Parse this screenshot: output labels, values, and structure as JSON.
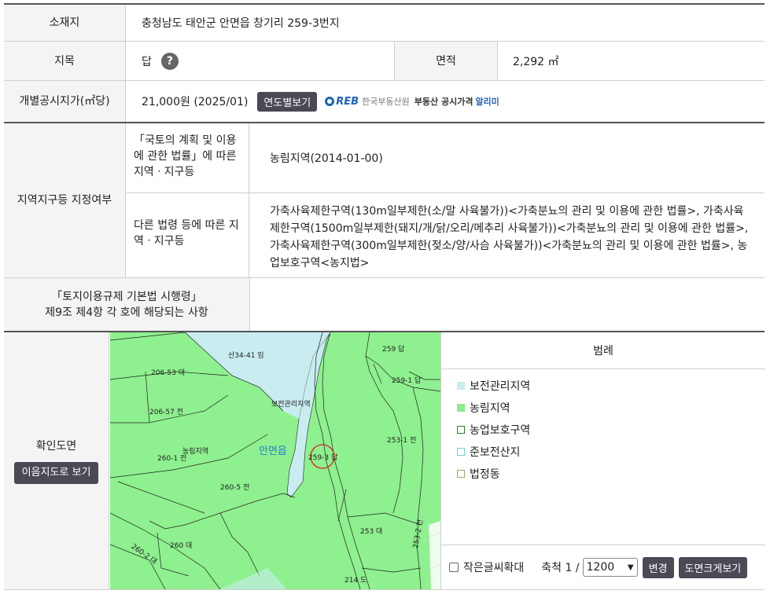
{
  "location": {
    "label": "소재지",
    "value": "충청남도 태안군 안면읍 창기리 259-3번지"
  },
  "land_category": {
    "label": "지목",
    "value": "답",
    "help_icon": "?"
  },
  "area": {
    "label": "면적",
    "value": "2,292 ㎡"
  },
  "price": {
    "label": "개별공시지가(㎡당)",
    "value": "21,000원 (2025/01)",
    "yearly_button": "연도별보기",
    "reb_logo": "REB",
    "reb_org": "한국부동산원",
    "reb_service_a": "부동산 공시가격",
    "reb_service_b": "알리미"
  },
  "zoning": {
    "label": "지역지구등 지정여부",
    "national_label": "「국토의 계획 및 이용에 관한 법률」에 따른 지역ㆍ지구등",
    "national_value": "농림지역(2014-01-00)",
    "other_label": "다른 법령 등에 따른 지역ㆍ지구등",
    "other_value": "가축사육제한구역(130m일부제한(소/말 사육불가))<가축분뇨의 관리 및 이용에 관한 법률>, 가축사육제한구역(1500m일부제한(돼지/개/닭/오리/메추리 사육불가))<가축분뇨의 관리 및 이용에 관한 법률>, 가축사육제한구역(300m일부제한(젖소/양/사슴 사육불가))<가축분뇨의 관리 및 이용에 관한 법률>, 농업보호구역<농지법>"
  },
  "enforcement": {
    "label_line1": "「토지이용규제 기본법 시행령」",
    "label_line2": "제9조 제4항 각 호에 해당되는 사항",
    "value": ""
  },
  "map_section": {
    "label": "확인도면",
    "view_button": "이음지도로 보기",
    "map_labels": {
      "p1": "산34-41 임",
      "p2": "259 답",
      "p3": "206-53 대",
      "p4": "259-1 답",
      "p5": "보전관리지역",
      "p6": "206-57 전",
      "p7": "253-1 전",
      "p8": "안면읍",
      "p9": "농림지역",
      "p10": "259-3 답",
      "p11": "260-1 전",
      "p12": "260-5 전",
      "p13": "253 대",
      "p14": "253-2 전",
      "p15": "260-2 대",
      "p16": "260 대",
      "p17": "214 도"
    },
    "legend_title": "범례",
    "legend": [
      {
        "label": "보전관리지역",
        "color": "#c8ecf0",
        "border": "#c8ecf0"
      },
      {
        "label": "농림지역",
        "color": "#8ee88e",
        "border": "#8ee88e"
      },
      {
        "label": "농업보호구역",
        "color": "#ffffff",
        "border": "#2e7d32"
      },
      {
        "label": "준보전산지",
        "color": "#ffffff",
        "border": "#6ed3d3"
      },
      {
        "label": "법정동",
        "color": "#ffffff",
        "border": "#b89a6a"
      }
    ],
    "small_text_label": "작은글씨확대",
    "scale_label": "축척 1 /",
    "scale_value": "1200",
    "change_button": "변경",
    "enlarge_button": "도면크게보기"
  },
  "colors": {
    "header_bg": "#f4f4f4",
    "button_dark": "#4a4a55",
    "map_green": "#8ef08e",
    "map_blue": "#c8ecf0"
  }
}
